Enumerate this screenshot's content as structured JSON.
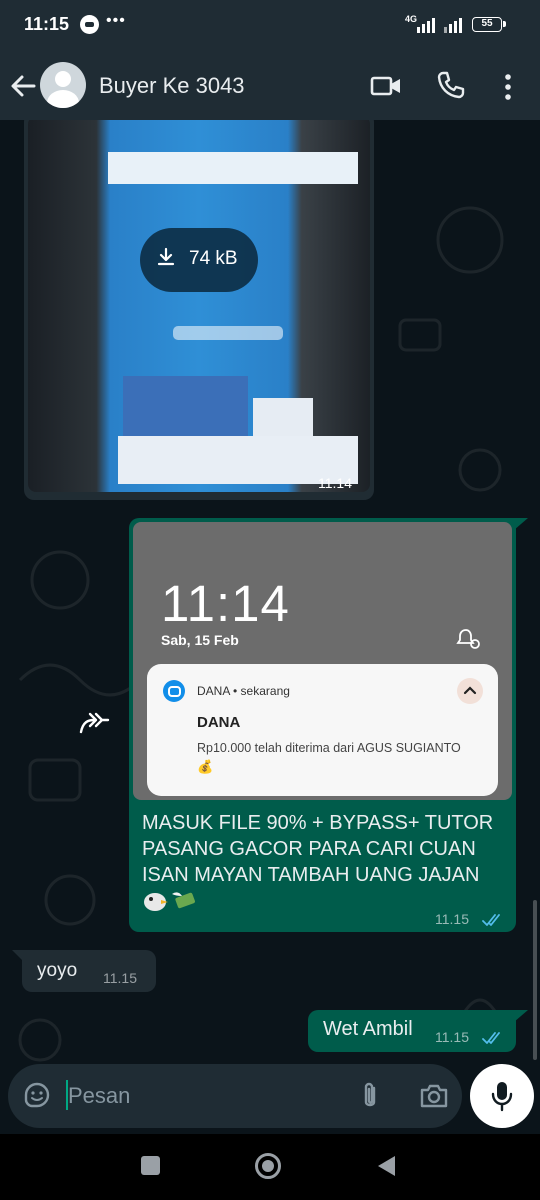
{
  "status_bar": {
    "time": "11:15",
    "more": "•••",
    "network": "4G",
    "battery": "55"
  },
  "header": {
    "contact_name": "Buyer Ke 3043"
  },
  "messages": {
    "image": {
      "file_size": "74 kB",
      "time": "11.14"
    },
    "forwarded": {
      "lock_time": "11:14",
      "lock_date": "Sab, 15 Feb",
      "notif_app": "DANA • sekarang",
      "notif_title": "DANA",
      "notif_text": "Rp10.000 telah diterima dari AGUS SUGIANTO",
      "notif_emoji": "💰",
      "caption": "MASUK FILE 90% + BYPASS+ TUTOR PASANG GACOR PARA CARI CUAN ISAN MAYAN TAMBAH UANG JAJAN",
      "time": "11.15",
      "status": "read"
    },
    "incoming": {
      "text": "yoyo",
      "time": "11.15"
    },
    "outgoing": {
      "text": "Wet Ambil",
      "time": "11.15",
      "status": "read"
    }
  },
  "composer": {
    "placeholder": "Pesan"
  },
  "colors": {
    "background": "#0b141a",
    "header": "#1f2c34",
    "outgoing_bubble": "#005c4b",
    "incoming_bubble": "#202c33",
    "read_tick": "#53bdeb",
    "accent": "#00a884"
  }
}
